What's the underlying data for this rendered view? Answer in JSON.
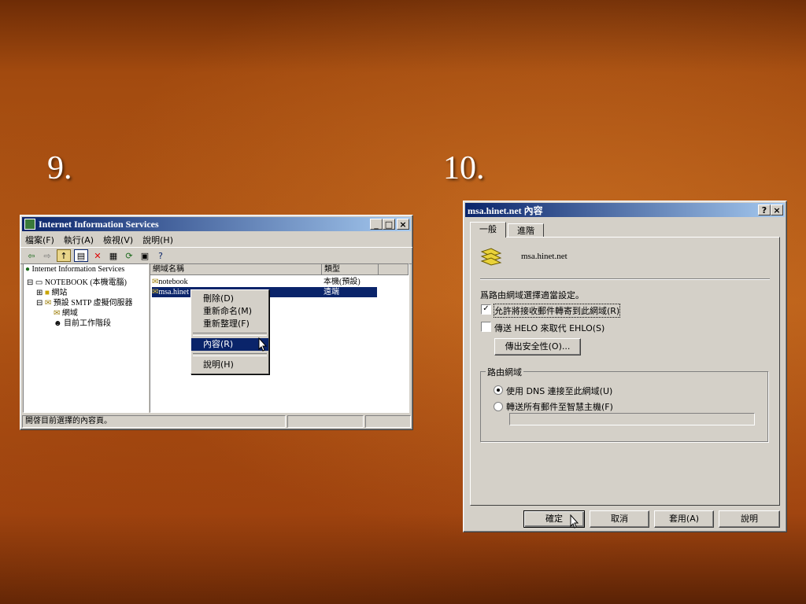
{
  "slide": {
    "label_left": "9.",
    "label_right": "10."
  },
  "iis": {
    "title": "Internet Information Services",
    "menus": [
      "檔案(F)",
      "執行(A)",
      "檢視(V)",
      "說明(H)"
    ],
    "tree": {
      "root": "Internet Information Services",
      "computer": "NOTEBOOK (本機電腦)",
      "websites": "網站",
      "smtp": "預設 SMTP 虛擬伺服器",
      "domains": "網域",
      "sessions": "目前工作階段"
    },
    "list": {
      "col_name": "網域名稱",
      "col_type": "類型",
      "rows": [
        {
          "name": "notebook",
          "type": "本機(預設)"
        },
        {
          "name": "msa.hinet",
          "type": "遠端"
        }
      ]
    },
    "context_menu": {
      "delete": "刪除(D)",
      "rename": "重新命名(M)",
      "refresh": "重新整理(F)",
      "properties": "內容(R)",
      "help": "說明(H)"
    },
    "status": "開啓目前選擇的內容頁。"
  },
  "props": {
    "title": "msa.hinet.net 內容",
    "tabs": [
      "一般",
      "進階"
    ],
    "domain_name": "msa.hinet.net",
    "intro": "爲路由網域選擇適當設定。",
    "check_relay": {
      "label": "允許將接收郵件轉寄到此網域(R)",
      "checked": true
    },
    "check_helo": {
      "label": "傳送 HELO 來取代 EHLO(S)",
      "checked": false
    },
    "outbound_security": "傳出安全性(O)...",
    "route_group": "路由網域",
    "radio_dns": {
      "label": "使用 DNS 連接至此網域(U)",
      "checked": true
    },
    "radio_smarthost": {
      "label": "轉送所有郵件至智慧主機(F)",
      "checked": false
    },
    "smarthost_value": "",
    "buttons": {
      "ok": "確定",
      "cancel": "取消",
      "apply": "套用(A)",
      "help": "說明"
    }
  }
}
